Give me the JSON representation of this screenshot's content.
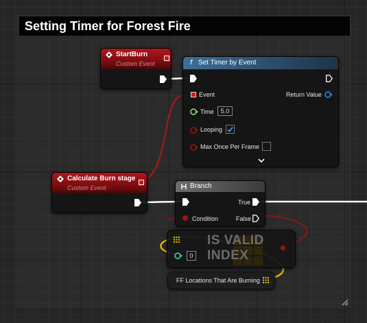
{
  "comment": {
    "title": "Setting Timer for Forest Fire"
  },
  "nodes": {
    "start_burn": {
      "title": "StartBurn",
      "subtitle": "Custom Event"
    },
    "set_timer": {
      "title": "Set Timer by Event",
      "event_label": "Event",
      "return_label": "Return Value",
      "time_label": "Time",
      "time_value": "5.0",
      "looping_label": "Looping",
      "looping_checked": true,
      "max_once_label": "Max Once Per Frame",
      "max_once_checked": false
    },
    "calc_burn": {
      "title": "Calculate Burn stage",
      "subtitle": "Custom Event"
    },
    "branch": {
      "title": "Branch",
      "condition_label": "Condition",
      "true_label": "True",
      "false_label": "False"
    },
    "is_valid": {
      "line1": "IS VALID",
      "line2": "INDEX",
      "index_value": "0"
    },
    "ff_locations": {
      "label": "FF Locations That Are Burning"
    }
  },
  "colors": {
    "event_red": "#b0161c",
    "function_blue": "#3d6f99",
    "exec_white": "#ffffff",
    "bool_red": "#a31212",
    "float_green": "#80f082",
    "int_teal": "#2be3b2",
    "array_yellow": "#f2c300",
    "delegate_blue": "#2f88ff"
  }
}
